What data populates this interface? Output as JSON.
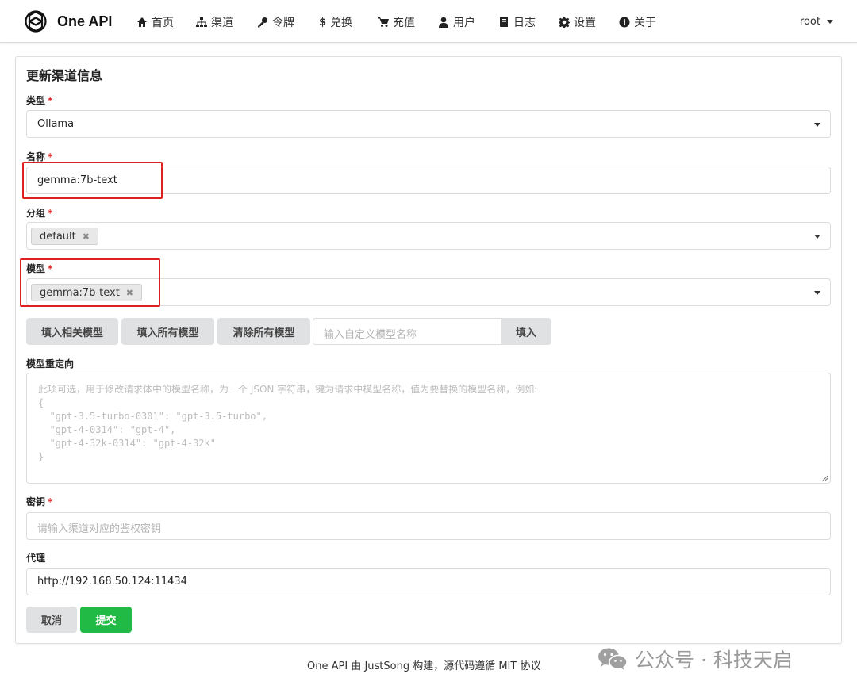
{
  "nav": {
    "brand": "One API",
    "items": [
      {
        "label": "首页",
        "icon": "home-icon"
      },
      {
        "label": "渠道",
        "icon": "sitemap-icon"
      },
      {
        "label": "令牌",
        "icon": "key-icon"
      },
      {
        "label": "兑换",
        "icon": "dollar-icon"
      },
      {
        "label": "充值",
        "icon": "cart-icon"
      },
      {
        "label": "用户",
        "icon": "user-icon"
      },
      {
        "label": "日志",
        "icon": "book-icon"
      },
      {
        "label": "设置",
        "icon": "gear-icon"
      },
      {
        "label": "关于",
        "icon": "info-icon"
      }
    ],
    "user": "root"
  },
  "form": {
    "title": "更新渠道信息",
    "required_mark": "*",
    "type": {
      "label": "类型",
      "value": "Ollama"
    },
    "name": {
      "label": "名称",
      "value": "gemma:7b-text"
    },
    "group": {
      "label": "分组",
      "tag": "default"
    },
    "models": {
      "label": "模型",
      "tag": "gemma:7b-text"
    },
    "buttons": {
      "fill_related": "填入相关模型",
      "fill_all": "填入所有模型",
      "clear_all": "清除所有模型",
      "custom_placeholder": "输入自定义模型名称",
      "fill": "填入"
    },
    "model_mapping": {
      "label": "模型重定向",
      "placeholder_line1": "此项可选，用于修改请求体中的模型名称，为一个 JSON 字符串，键为请求中模型名称，值为要替换的模型名称，例如:",
      "placeholder_code": "{\n  \"gpt-3.5-turbo-0301\": \"gpt-3.5-turbo\",\n  \"gpt-4-0314\": \"gpt-4\",\n  \"gpt-4-32k-0314\": \"gpt-4-32k\"\n}"
    },
    "key": {
      "label": "密钥",
      "placeholder": "请输入渠道对应的鉴权密钥"
    },
    "proxy": {
      "label": "代理",
      "value": "http://192.168.50.124:11434"
    },
    "cancel": "取消",
    "submit": "提交"
  },
  "footer": {
    "app": "One API",
    "by": " 由 ",
    "author": "JustSong",
    "built": " 构建，源代码遵循 ",
    "license": "MIT 协议"
  },
  "watermark": {
    "text": "公众号 · 科技天启"
  },
  "colors": {
    "accent_green": "#21ba45",
    "highlight_red": "#e02020",
    "link_blue": "#2b6fc2",
    "required_red": "#db2828"
  }
}
